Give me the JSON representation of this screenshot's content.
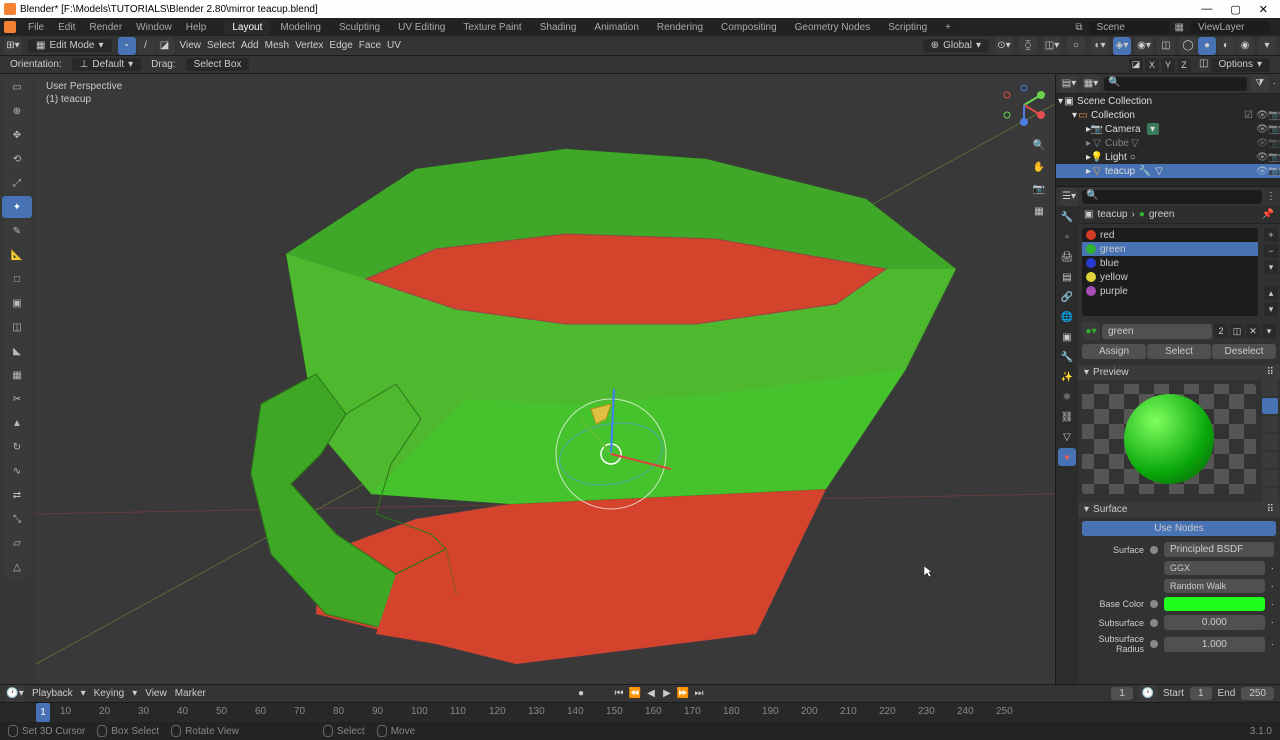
{
  "window": {
    "title": "Blender* [F:\\Models\\TUTORIALS\\Blender 2.80\\mirror teacup.blend]"
  },
  "menubar": {
    "items": [
      "File",
      "Edit",
      "Render",
      "Window",
      "Help"
    ],
    "tabs": [
      "Layout",
      "Modeling",
      "Sculpting",
      "UV Editing",
      "Texture Paint",
      "Shading",
      "Animation",
      "Rendering",
      "Compositing",
      "Geometry Nodes",
      "Scripting"
    ],
    "active_tab": 0,
    "scene": "Scene",
    "viewlayer": "ViewLayer"
  },
  "toolbar": {
    "mode": "Edit Mode",
    "menus": [
      "View",
      "Select",
      "Add",
      "Mesh",
      "Vertex",
      "Edge",
      "Face",
      "UV"
    ],
    "transform": "Global"
  },
  "options": {
    "orientation_label": "Orientation:",
    "orientation": "Default",
    "drag_label": "Drag:",
    "drag": "Select Box",
    "axes": [
      "X",
      "Y",
      "Z"
    ],
    "options_btn": "Options"
  },
  "viewport": {
    "perspective": "User Perspective",
    "object": "(1) teacup"
  },
  "outliner": {
    "root": "Scene Collection",
    "collection": "Collection",
    "items": [
      "Camera",
      "Cube",
      "Light",
      "teacup"
    ],
    "selected": "teacup"
  },
  "props": {
    "breadcrumb_obj": "teacup",
    "breadcrumb_mat": "green",
    "materials": [
      {
        "name": "red",
        "color": "#d43b29"
      },
      {
        "name": "green",
        "color": "#2fb52f"
      },
      {
        "name": "blue",
        "color": "#2a3ad4"
      },
      {
        "name": "yellow",
        "color": "#e0d33a"
      },
      {
        "name": "purple",
        "color": "#a44db3"
      }
    ],
    "selected_material_idx": 1,
    "material_name": "green",
    "assign": "Assign",
    "select": "Select",
    "deselect": "Deselect",
    "preview_label": "Preview",
    "surface_label": "Surface",
    "use_nodes": "Use Nodes",
    "surface_field_label": "Surface",
    "surface_shader": "Principled BSDF",
    "dist_ggx": "GGX",
    "subsurf_method": "Random Walk",
    "base_color_label": "Base Color",
    "base_color": "#1eff1e",
    "subsurface_label": "Subsurface",
    "subsurface": "0.000",
    "subsurf_radius_label": "Subsurface Radius",
    "subsurf_radius": "1.000"
  },
  "timeline": {
    "playback": "Playback",
    "keying": "Keying",
    "view": "View",
    "marker": "Marker",
    "current": "1",
    "start_label": "Start",
    "start": "1",
    "end_label": "End",
    "end": "250",
    "frames": [
      "10",
      "20",
      "30",
      "40",
      "50",
      "60",
      "70",
      "80",
      "90",
      "100",
      "110",
      "120",
      "130",
      "140",
      "150",
      "160",
      "170",
      "180",
      "190",
      "200",
      "210",
      "220",
      "230",
      "240",
      "250"
    ]
  },
  "statusbar": {
    "items": [
      "Set 3D Cursor",
      "Box Select",
      "Rotate View",
      "Select",
      "Move"
    ],
    "version": "3.1.0"
  }
}
